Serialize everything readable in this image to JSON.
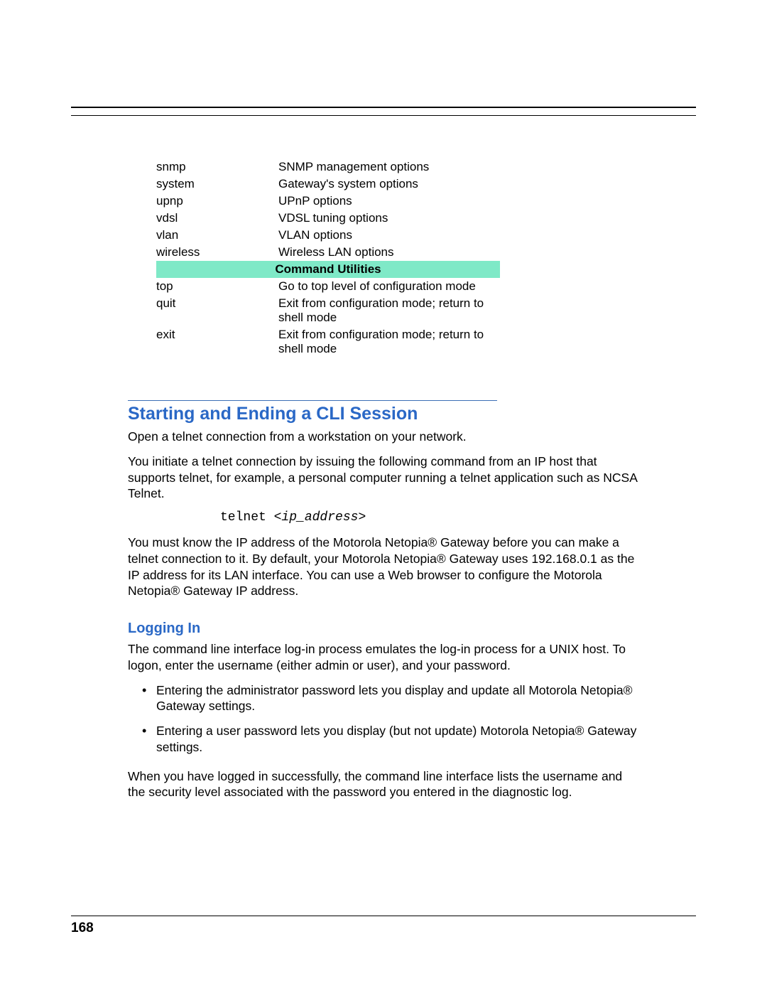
{
  "table": {
    "rows_top": [
      {
        "cmd": "snmp",
        "desc": "SNMP management options"
      },
      {
        "cmd": "system",
        "desc": "Gateway's system options"
      },
      {
        "cmd": "upnp",
        "desc": "UPnP options"
      },
      {
        "cmd": "vdsl",
        "desc": "VDSL tuning options"
      },
      {
        "cmd": "vlan",
        "desc": "VLAN options"
      },
      {
        "cmd": "wireless",
        "desc": "Wireless LAN options"
      }
    ],
    "header": "Command Utilities",
    "rows_bottom": [
      {
        "cmd": "top",
        "desc": "Go to top level of configuration mode"
      },
      {
        "cmd": "quit",
        "desc": "Exit from configuration mode; return to shell mode"
      },
      {
        "cmd": "exit",
        "desc": "Exit from configuration mode; return to shell mode"
      }
    ]
  },
  "section": {
    "title": "Starting and Ending a CLI Session",
    "p1": "Open a telnet connection from a workstation on your network.",
    "p2": "You initiate a telnet connection by issuing the following command from an IP host that supports telnet, for example, a personal computer running a telnet application such as NCSA Telnet.",
    "code_fixed": "telnet <",
    "code_arg": "ip_address",
    "code_close": ">",
    "p3": "You must know the IP address of the Motorola Netopia® Gateway before you can make a telnet connection to it. By default, your Motorola Netopia® Gateway uses 192.168.0.1 as the IP address for its LAN interface. You can use a Web browser to configure the Motorola Netopia® Gateway IP address."
  },
  "subsection": {
    "title": "Logging In",
    "p1": "The command line interface log-in process emulates the log-in process for a UNIX host. To logon, enter the username (either admin or user), and your password.",
    "bullets": [
      "Entering the administrator password lets you display and update all Motorola Netopia® Gateway settings.",
      "Entering a user password lets you display (but not update) Motorola Netopia® Gateway settings."
    ],
    "p2": "When you have logged in successfully, the command line interface lists the username and the security level associated with the password you entered in the diagnostic log."
  },
  "page_number": "168"
}
